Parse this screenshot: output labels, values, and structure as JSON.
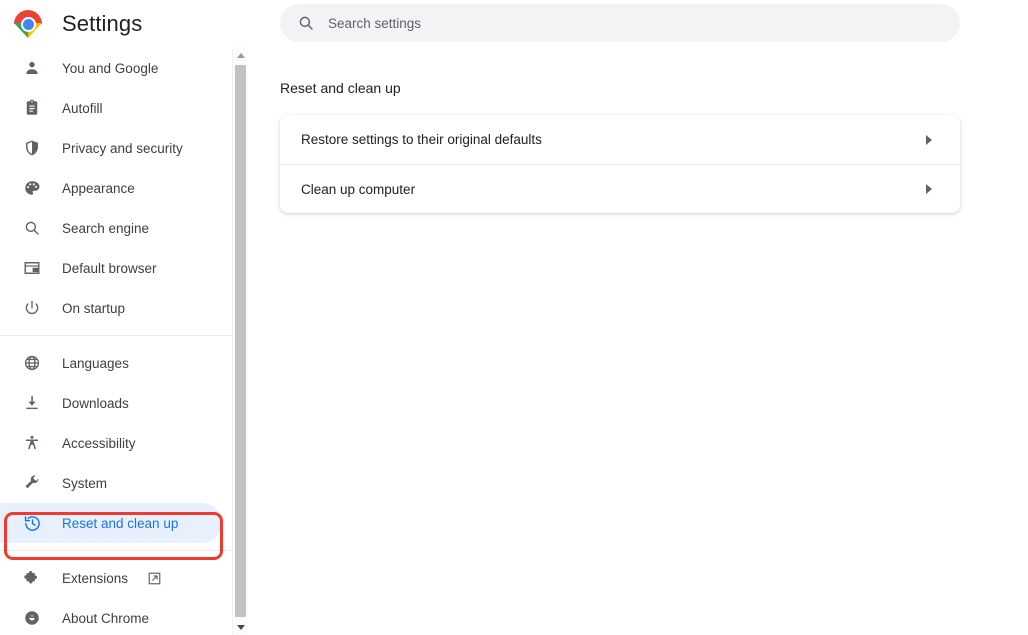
{
  "app": {
    "title": "Settings",
    "logo_icon": "chrome-logo"
  },
  "search": {
    "placeholder": "Search settings",
    "value": "",
    "icon": "search-icon"
  },
  "sidebar": {
    "groups": [
      {
        "items": [
          {
            "label": "You and Google",
            "icon": "person-icon",
            "selected": false
          },
          {
            "label": "Autofill",
            "icon": "clipboard-icon",
            "selected": false
          },
          {
            "label": "Privacy and security",
            "icon": "shield-icon",
            "selected": false
          },
          {
            "label": "Appearance",
            "icon": "palette-icon",
            "selected": false
          },
          {
            "label": "Search engine",
            "icon": "search-icon",
            "selected": false
          },
          {
            "label": "Default browser",
            "icon": "browser-window-icon",
            "selected": false
          },
          {
            "label": "On startup",
            "icon": "power-icon",
            "selected": false
          }
        ]
      },
      {
        "items": [
          {
            "label": "Languages",
            "icon": "globe-icon",
            "selected": false
          },
          {
            "label": "Downloads",
            "icon": "download-icon",
            "selected": false
          },
          {
            "label": "Accessibility",
            "icon": "accessibility-icon",
            "selected": false
          },
          {
            "label": "System",
            "icon": "wrench-icon",
            "selected": false
          },
          {
            "label": "Reset and clean up",
            "icon": "restore-clock-icon",
            "selected": true
          }
        ]
      },
      {
        "items": [
          {
            "label": "Extensions",
            "icon": "puzzle-icon",
            "selected": false,
            "external": true,
            "external_icon": "external-link-icon"
          },
          {
            "label": "About Chrome",
            "icon": "chrome-outline-icon",
            "selected": false
          }
        ]
      }
    ]
  },
  "main": {
    "section_title": "Reset and clean up",
    "rows": [
      {
        "label": "Restore settings to their original defaults",
        "chevron": "chevron-right-icon"
      },
      {
        "label": "Clean up computer",
        "chevron": "chevron-right-icon"
      }
    ]
  },
  "scrollbar": {
    "up_icon": "scroll-up-arrow-icon",
    "down_icon": "scroll-down-arrow-icon"
  },
  "annotation": {
    "color": "#ef3b2d",
    "target": "Reset and clean up"
  },
  "colors": {
    "accent": "#1a73e8",
    "selected_bg": "#e8f0fe",
    "text_primary": "#202124",
    "text_secondary": "#5f6368",
    "search_bg": "#f1f3f4",
    "annotation_red": "#ef3b2d"
  }
}
